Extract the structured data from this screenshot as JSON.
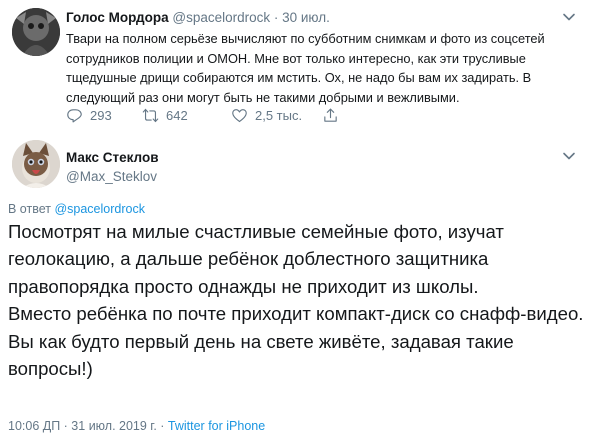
{
  "parent_tweet": {
    "author_name": "Голос Мордора",
    "author_handle": "@spacelordrock",
    "separator": " · ",
    "date": "30 июл.",
    "text": "Твари на полном серьёзе вычисляют по субботним снимкам и фото из соцсетей сотрудников полиции и ОМОН. Мне вот только интересно, как эти трусливые тщедушные дрищи собираются им мстить. Ох, не надо бы вам их задирать. В следующий раз они могут быть не такими добрыми и вежливыми.",
    "reply_count": "293",
    "retweet_count": "642",
    "like_count": "2,5 тыс."
  },
  "main_tweet": {
    "author_name": "Макс Стеклов",
    "author_handle": "@Max_Steklov",
    "reply_prefix": "В ответ ",
    "reply_handle": "@spacelordrock",
    "paragraphs": [
      "Посмотрят на милые счастливые семейные фото, изучат геолокацию, а дальше ребёнок доблестного защитника правопорядка просто однажды не приходит из школы.",
      "Вместо ребёнка по почте приходит компакт-диск со снафф-видео.",
      "Вы как будто первый день на свете живёте, задавая такие вопросы!)"
    ],
    "timestamp": "10:06 ДП · 31 июл. 2019 г. · ",
    "source": "Twitter for iPhone"
  },
  "icons": [
    "reply-icon",
    "retweet-icon",
    "like-icon",
    "share-icon",
    "caret-down-icon"
  ],
  "colors": {
    "link": "#1b95e0",
    "muted": "#657786",
    "text": "#14171a"
  }
}
